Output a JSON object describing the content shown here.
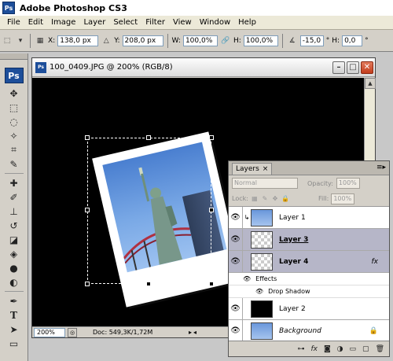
{
  "app": {
    "badge": "Ps",
    "title": "Adobe Photoshop CS3"
  },
  "menu": [
    "File",
    "Edit",
    "Image",
    "Layer",
    "Select",
    "Filter",
    "View",
    "Window",
    "Help"
  ],
  "options": {
    "x_label": "X:",
    "x_value": "138,0 px",
    "y_label": "Y:",
    "y_value": "208,0 px",
    "w_label": "W:",
    "w_value": "100,0%",
    "h_label": "H:",
    "h_value": "100,0%",
    "angle_value": "-15,0",
    "angle_unit": "°",
    "hskew_label": "H:",
    "hskew_value": "0,0",
    "hskew_unit": "°"
  },
  "toolbox": {
    "logo": "Ps"
  },
  "document": {
    "title": "100_0409.JPG @ 200% (RGB/8)",
    "zoom": "200%",
    "doc_info": "Doc: 549,3K/1,72M"
  },
  "layers_panel": {
    "tab": "Layers",
    "tab_close": "×",
    "blend_mode": "Normal",
    "opacity_label": "Opacity:",
    "opacity_value": "100%",
    "lock_label": "Lock:",
    "fill_label": "Fill:",
    "fill_value": "100%",
    "layers": [
      {
        "name": "Layer 1",
        "style": "normal",
        "thumb": "photo",
        "linked": true
      },
      {
        "name": "Layer 3",
        "style": "bold-underline",
        "thumb": "checker",
        "selected": true
      },
      {
        "name": "Layer 4",
        "style": "bold",
        "thumb": "checker",
        "fx": "fx",
        "selected": true
      }
    ],
    "effects_label": "Effects",
    "drop_shadow_label": "Drop Shadow",
    "layer2": {
      "name": "Layer 2"
    },
    "background": {
      "name": "Background"
    }
  }
}
